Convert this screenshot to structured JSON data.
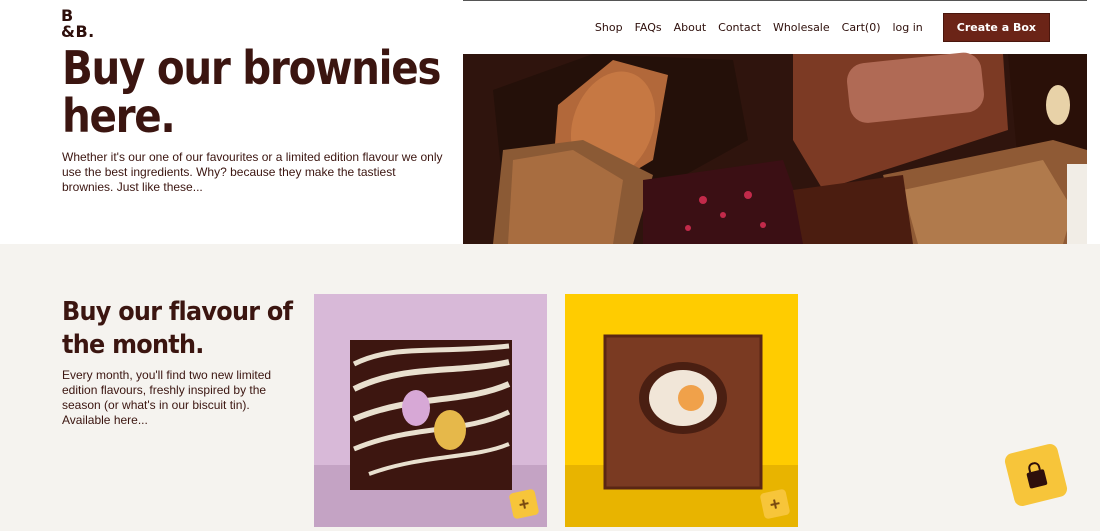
{
  "logo": {
    "line1": "B",
    "line2": "&B."
  },
  "nav": {
    "items": [
      "Shop",
      "FAQs",
      "About",
      "Contact",
      "Wholesale",
      "Cart(0)",
      "log in"
    ],
    "cta": "Create a Box"
  },
  "hero": {
    "title_line1": "Buy our brownies",
    "title_line2": "here.",
    "text": "Whether it's our one of our favourites or a limited edition flavour we only use the best ingredients. Why? because they make the tastiest brownies. Just like these..."
  },
  "flavour": {
    "title_line1": "Buy our flavour of",
    "title_line2": "the month.",
    "text": "Every month, you'll find two new limited edition flavours, freshly inspired by the season (or what's in our biscuit tin). Available here..."
  },
  "products": [
    {
      "name": "mini-egg-white-chocolate-brownie",
      "bg": "#d8b9d8"
    },
    {
      "name": "creme-egg-brownie",
      "bg": "#ffcc00"
    }
  ],
  "icons": {
    "add": "+",
    "bag": "shopping-bag-icon"
  }
}
